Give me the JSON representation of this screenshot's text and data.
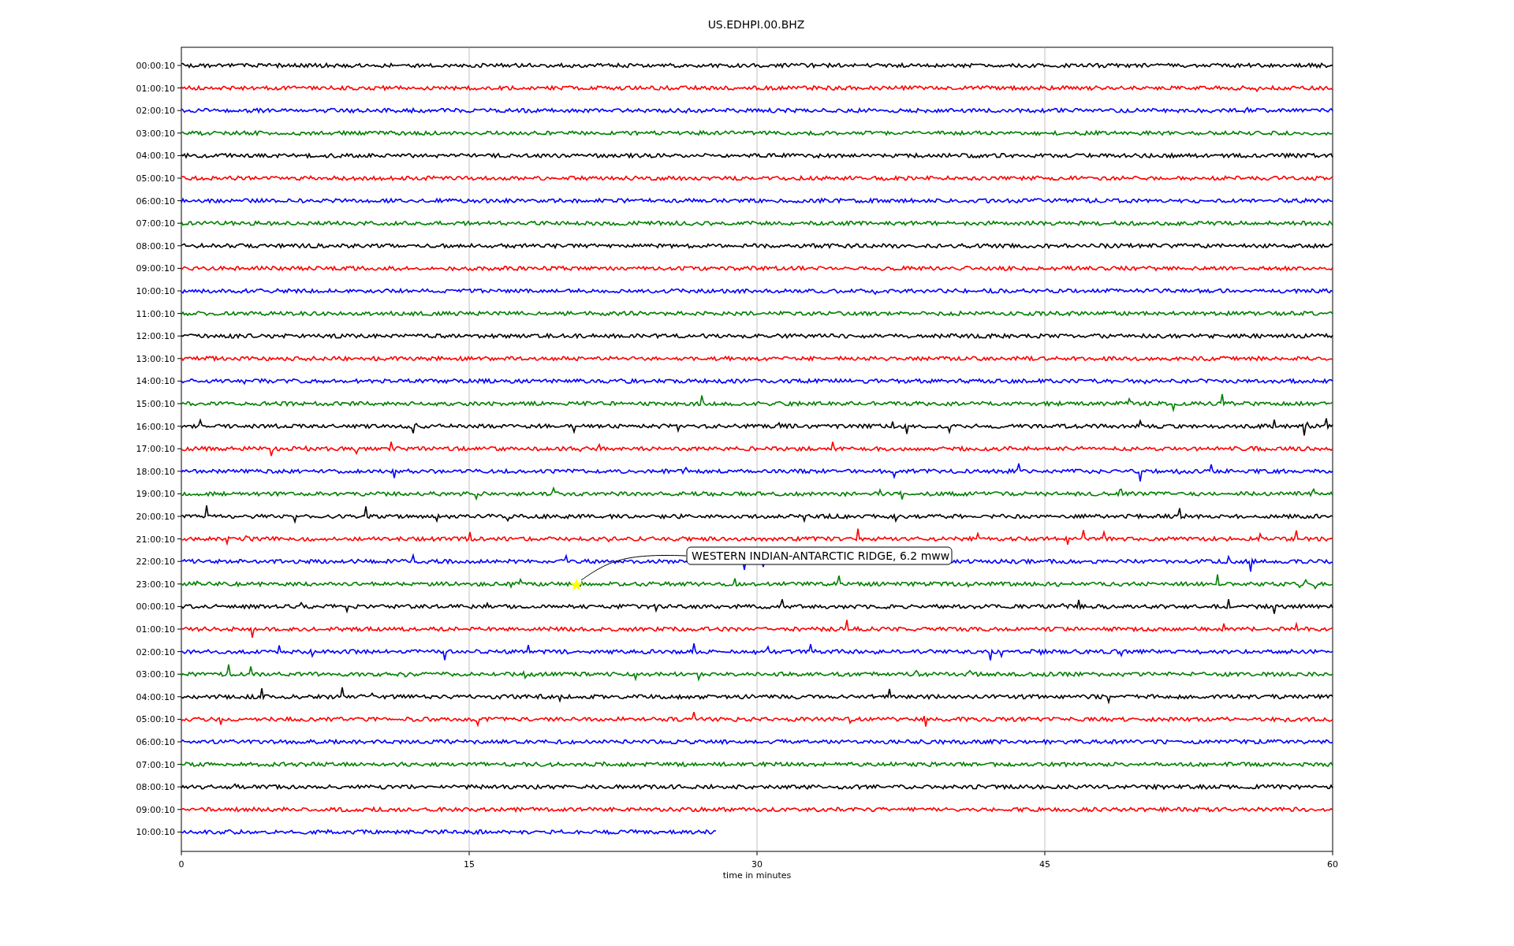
{
  "title": "US.EDHPI.00.BHZ",
  "traces": [
    {
      "label": "00:00:10",
      "color": "#000000",
      "level": 1
    },
    {
      "label": "01:00:10",
      "color": "#ff0000",
      "level": 1
    },
    {
      "label": "02:00:10",
      "color": "#0000ff",
      "level": 1
    },
    {
      "label": "03:00:10",
      "color": "#008000",
      "level": 1
    },
    {
      "label": "04:00:10",
      "color": "#000000",
      "level": 1
    },
    {
      "label": "05:00:10",
      "color": "#ff0000",
      "level": 1
    },
    {
      "label": "06:00:10",
      "color": "#0000ff",
      "level": 1
    },
    {
      "label": "07:00:10",
      "color": "#008000",
      "level": 1
    },
    {
      "label": "08:00:10",
      "color": "#000000",
      "level": 1
    },
    {
      "label": "09:00:10",
      "color": "#ff0000",
      "level": 1
    },
    {
      "label": "10:00:10",
      "color": "#0000ff",
      "level": 1
    },
    {
      "label": "11:00:10",
      "color": "#008000",
      "level": 1
    },
    {
      "label": "12:00:10",
      "color": "#000000",
      "level": 1
    },
    {
      "label": "13:00:10",
      "color": "#ff0000",
      "level": 1
    },
    {
      "label": "14:00:10",
      "color": "#0000ff",
      "level": 1
    },
    {
      "label": "15:00:10",
      "color": "#008000",
      "level": 1
    },
    {
      "label": "16:00:10",
      "color": "#000000",
      "level": 1
    },
    {
      "label": "17:00:10",
      "color": "#ff0000",
      "level": 1
    },
    {
      "label": "18:00:10",
      "color": "#0000ff",
      "level": 1
    },
    {
      "label": "19:00:10",
      "color": "#008000",
      "level": 1
    },
    {
      "label": "20:00:10",
      "color": "#000000",
      "level": 1
    },
    {
      "label": "21:00:10",
      "color": "#ff0000",
      "level": 1
    },
    {
      "label": "22:00:10",
      "color": "#0000ff",
      "level": 1
    },
    {
      "label": "23:00:10",
      "color": "#008000",
      "level": 1
    },
    {
      "label": "00:00:10",
      "color": "#000000",
      "level": 1
    },
    {
      "label": "01:00:10",
      "color": "#ff0000",
      "level": 1
    },
    {
      "label": "02:00:10",
      "color": "#0000ff",
      "level": 1
    },
    {
      "label": "03:00:10",
      "color": "#008000",
      "level": 1
    },
    {
      "label": "04:00:10",
      "color": "#000000",
      "level": 1
    },
    {
      "label": "05:00:10",
      "color": "#ff0000",
      "level": 1
    },
    {
      "label": "06:00:10",
      "color": "#0000ff",
      "level": 1
    },
    {
      "label": "07:00:10",
      "color": "#008000",
      "level": 1
    },
    {
      "label": "08:00:10",
      "color": "#000000",
      "level": 1
    },
    {
      "label": "09:00:10",
      "color": "#ff0000",
      "level": 1
    },
    {
      "label": "10:00:10",
      "color": "#0000ff",
      "level": 0.465
    }
  ],
  "x_axis": {
    "ticks": [
      "0",
      "15",
      "30",
      "45",
      "60"
    ],
    "label": "time in minutes"
  },
  "annotation": {
    "text": "WESTERN INDIAN-ANTARCTIC RIDGE, 6.2 mww"
  }
}
